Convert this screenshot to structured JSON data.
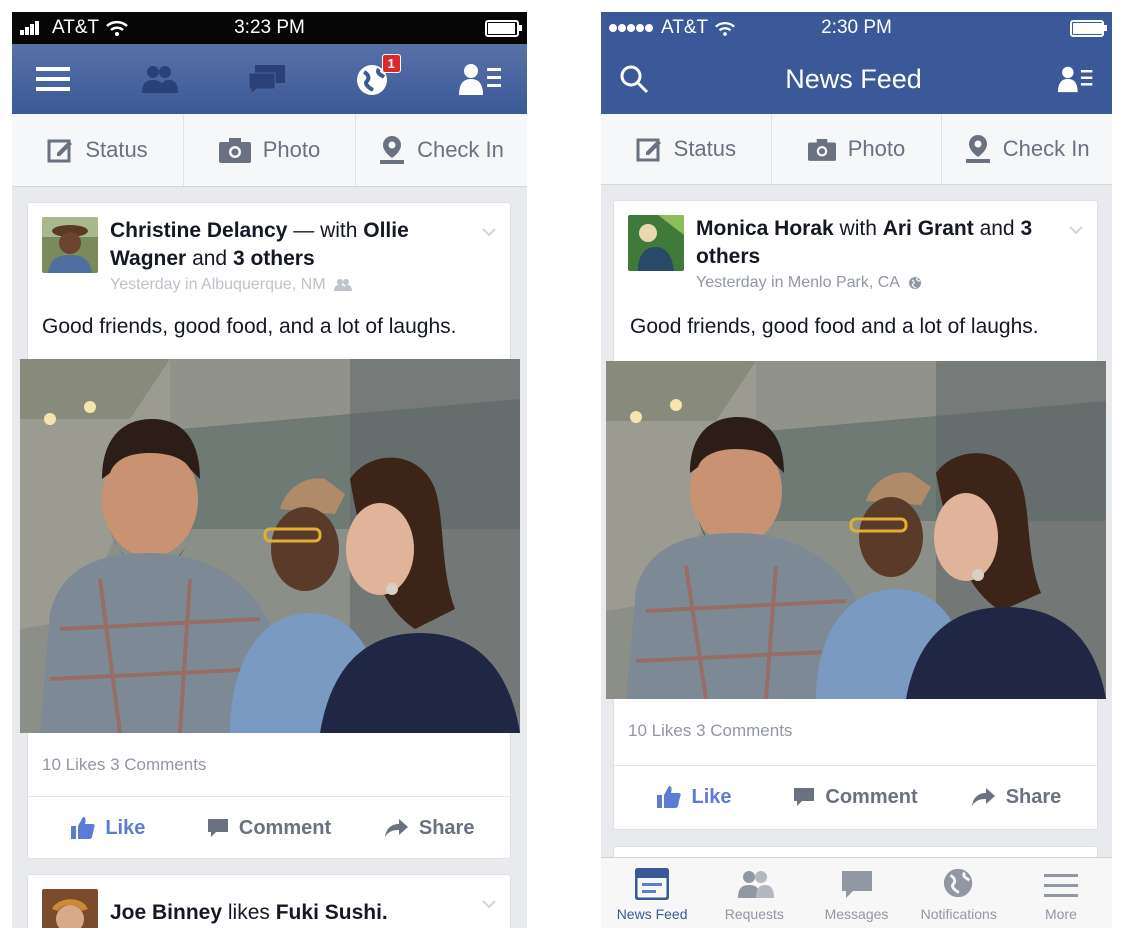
{
  "left": {
    "status": {
      "carrier": "AT&T",
      "time": "3:23 PM"
    },
    "nav": {
      "notification_count": "1"
    },
    "publisher": {
      "status": "Status",
      "photo": "Photo",
      "checkin": "Check In"
    },
    "post": {
      "author": "Christine Delancy",
      "with_sep": " — with ",
      "with_name": "Ollie Wagner",
      "and_text": " and ",
      "others": "3 others",
      "sub": "Yesterday in Albuquerque, NM",
      "text": "Good friends, good food, and a lot of laughs.",
      "likes": "10 Likes",
      "comments": "3 Comments",
      "like": "Like",
      "comment": "Comment",
      "share": "Share"
    },
    "post2": {
      "author": "Joe Binney",
      "verb": " likes ",
      "page": "Fuki Sushi."
    }
  },
  "right": {
    "status": {
      "carrier": "AT&T",
      "time": "2:30 PM"
    },
    "nav": {
      "title": "News Feed"
    },
    "publisher": {
      "status": "Status",
      "photo": "Photo",
      "checkin": "Check In"
    },
    "post": {
      "author": "Monica Horak",
      "with_sep": " with ",
      "with_name": "Ari Grant",
      "and_text": " and ",
      "others": "3 others",
      "sub": "Yesterday in Menlo Park, CA",
      "text": "Good friends, good food and a lot of laughs.",
      "likes": "10 Likes",
      "comments": "3 Comments",
      "like": "Like",
      "comment": "Comment",
      "share": "Share"
    },
    "tabs": [
      {
        "label": "News Feed",
        "icon": "news-feed-icon"
      },
      {
        "label": "Requests",
        "icon": "friend-requests-icon"
      },
      {
        "label": "Messages",
        "icon": "messages-icon"
      },
      {
        "label": "Notifications",
        "icon": "globe-icon"
      },
      {
        "label": "More",
        "icon": "menu-icon"
      }
    ]
  },
  "colors": {
    "brand": "#3b5998",
    "like": "#5b7bd5",
    "badge": "#e02727"
  }
}
